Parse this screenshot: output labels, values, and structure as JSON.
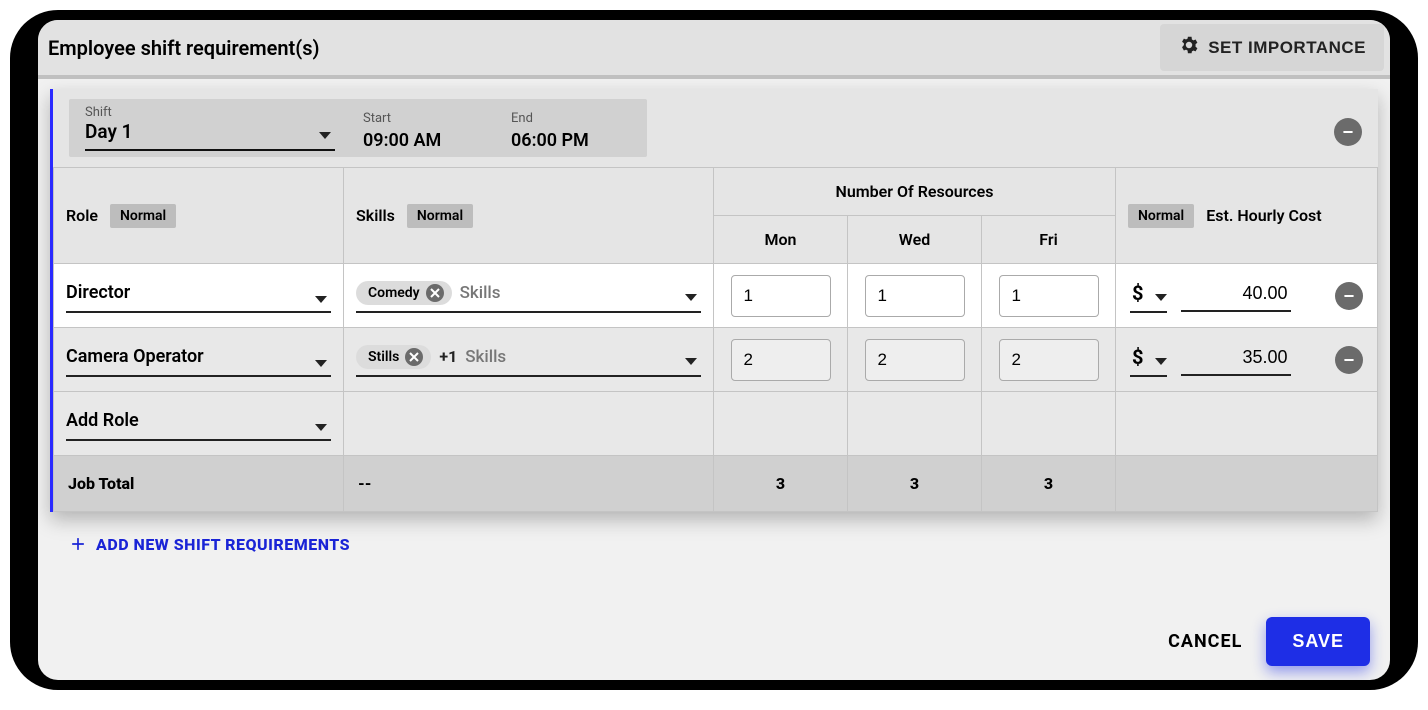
{
  "header": {
    "title": "Employee shift requirement(s)",
    "set_importance": "SET IMPORTANCE"
  },
  "shift": {
    "shift_label": "Shift",
    "shift_value": "Day 1",
    "start_label": "Start",
    "start_value": "09:00 AM",
    "end_label": "End",
    "end_value": "06:00 PM"
  },
  "columns": {
    "role": "Role",
    "skills": "Skills",
    "num_resources": "Number Of Resources",
    "days": [
      "Mon",
      "Wed",
      "Fri"
    ],
    "cost": "Est. Hourly Cost",
    "normal_badge": "Normal"
  },
  "rows": [
    {
      "role": "Director",
      "chips": [
        "Comedy"
      ],
      "extra_count": "",
      "skills_placeholder": "Skills",
      "counts": [
        "1",
        "1",
        "1"
      ],
      "currency": "$",
      "cost": "40.00",
      "highlight": true
    },
    {
      "role": "Camera Operator",
      "chips": [
        "Stills"
      ],
      "extra_count": "+1",
      "skills_placeholder": "Skills",
      "counts": [
        "2",
        "2",
        "2"
      ],
      "currency": "$",
      "cost": "35.00",
      "highlight": false
    }
  ],
  "add_role_placeholder": "Add Role",
  "totals": {
    "label": "Job Total",
    "skills_dash": "--",
    "counts": [
      "3",
      "3",
      "3"
    ]
  },
  "actions": {
    "add_new": "ADD NEW SHIFT REQUIREMENTS",
    "cancel": "CANCEL",
    "save": "SAVE"
  }
}
